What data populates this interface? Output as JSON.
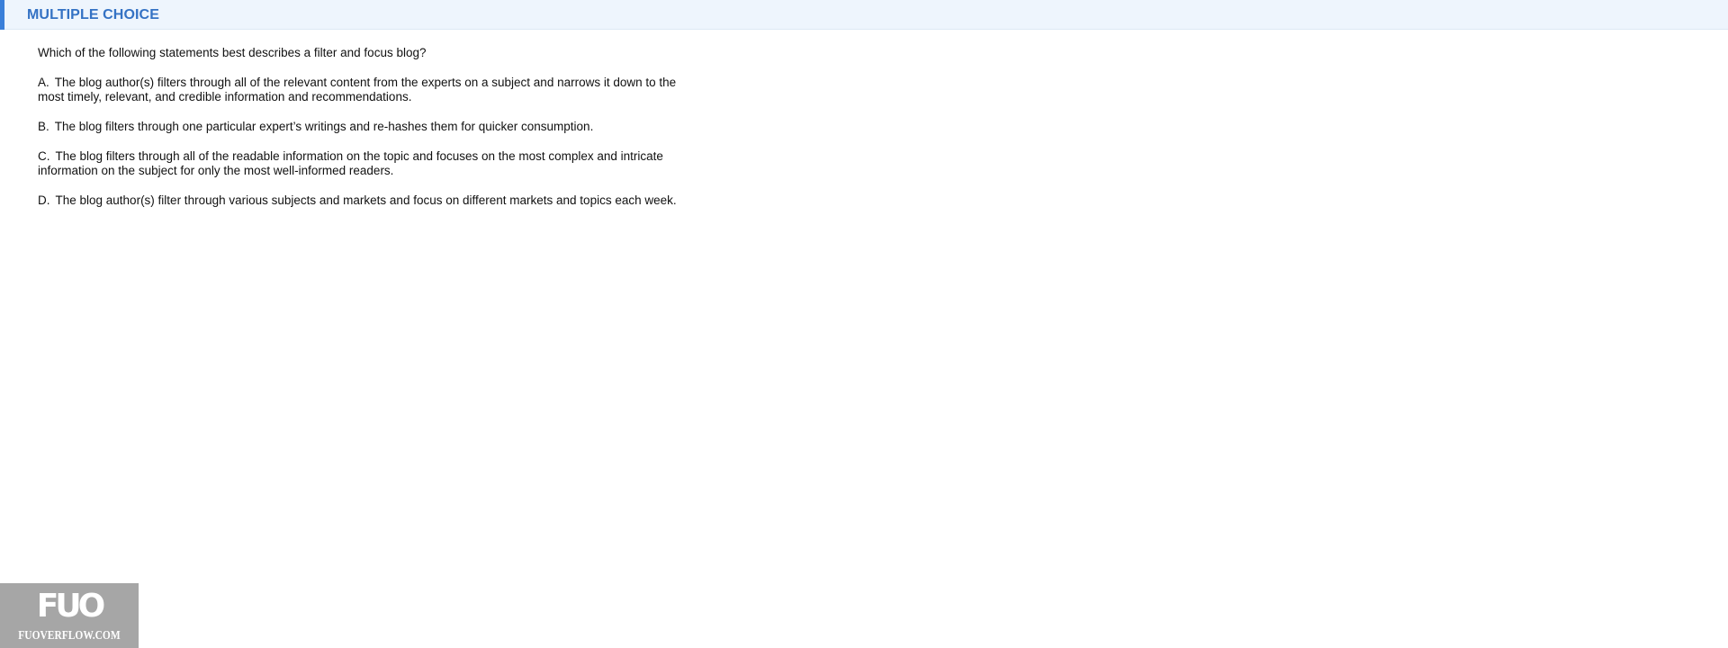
{
  "header": {
    "title": "MULTIPLE CHOICE",
    "accent_color": "#3a7fd9",
    "background_color": "#eef5fd"
  },
  "question": {
    "text": "Which of the following statements best describes a filter and focus blog?",
    "options": [
      {
        "letter": "A.",
        "text": "The blog author(s) filters through all of the relevant content from the experts on a subject and narrows it down to the most timely, relevant, and credible information and recommendations."
      },
      {
        "letter": "B.",
        "text": "The blog filters through one particular expert’s writings and re-hashes them for quicker consumption."
      },
      {
        "letter": "C.",
        "text": "The blog filters through all of the readable information on the topic and focuses on the most complex and intricate information on the subject for only the most well-informed readers."
      },
      {
        "letter": "D.",
        "text": "The blog author(s) filter through various subjects and markets and focus on different markets and topics each week."
      }
    ]
  },
  "watermark": {
    "logo": "FUO",
    "site": "FUOVERFLOW.COM"
  }
}
